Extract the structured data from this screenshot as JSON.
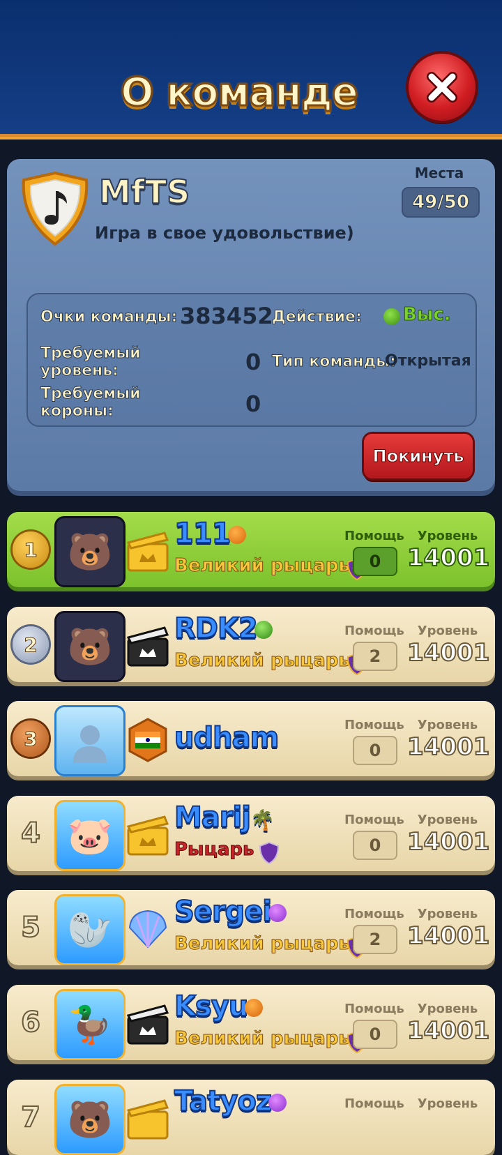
{
  "header": {
    "title": "О команде"
  },
  "team": {
    "name": "MfTS",
    "description": "Игра в свое удовольствие)",
    "slots_label": "Места",
    "slots_value": "49/50",
    "stats": {
      "points_label": "Очки команды:",
      "points_value": "383452",
      "activity_label": "Действие:",
      "activity_value": "Выс.",
      "req_level_label": "Требуемый уровень:",
      "req_level_value": "0",
      "type_label": "Тип команды:",
      "type_value": "Открытая",
      "req_crowns_label": "Требуемый короны:",
      "req_crowns_value": "0"
    },
    "leave_label": "Покинуть"
  },
  "members": {
    "help_label": "Помощь",
    "level_label": "Уровень",
    "rows": [
      {
        "rank": "1",
        "name": "111",
        "title": "Великий рыцарь",
        "help": "0",
        "level": "14001"
      },
      {
        "rank": "2",
        "name": "RDK2",
        "title": "Великий рыцарь",
        "help": "2",
        "level": "14001"
      },
      {
        "rank": "3",
        "name": "udham",
        "title": "",
        "help": "0",
        "level": "14001"
      },
      {
        "rank": "4",
        "name": "Marij",
        "title": "Рыцарь",
        "help": "0",
        "level": "14001"
      },
      {
        "rank": "5",
        "name": "Sergei",
        "title": "Великий рыцарь",
        "help": "2",
        "level": "14001"
      },
      {
        "rank": "6",
        "name": "Ksyu",
        "title": "Великий рыцарь",
        "help": "0",
        "level": "14001"
      },
      {
        "rank": "7",
        "name": "Tatyoz",
        "title": "",
        "help": "",
        "level": ""
      }
    ]
  },
  "colors": {
    "header_bg": "#0b2f6e",
    "panel_bg": "#6886b2",
    "current_row": "#8fcf38",
    "row_bg": "#f2e3bd",
    "close_red": "#d01d22"
  }
}
